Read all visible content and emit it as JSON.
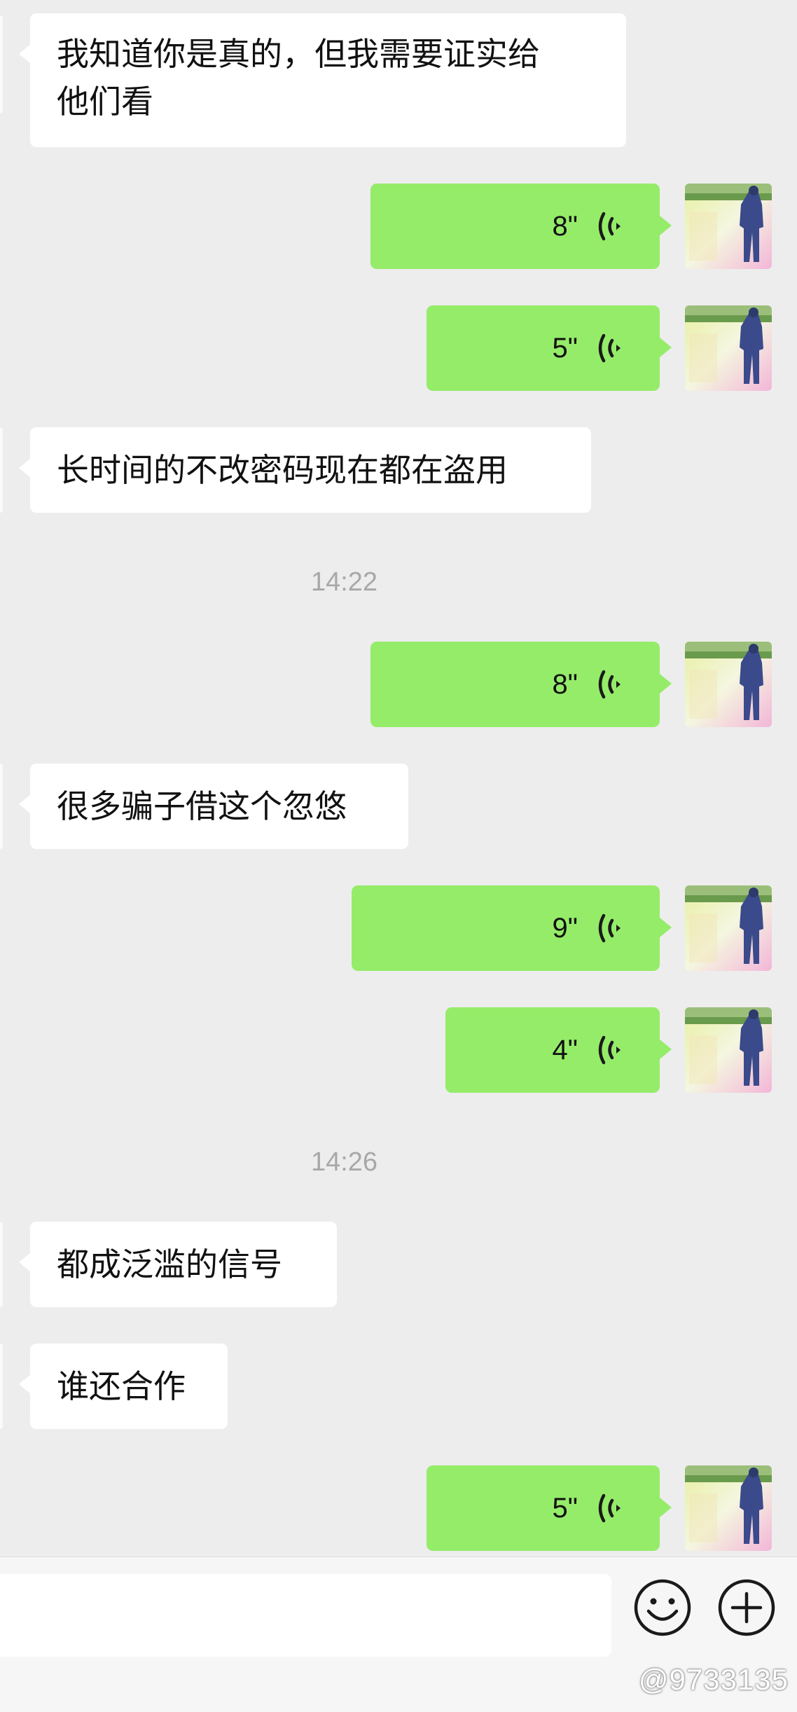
{
  "chat": {
    "messages": [
      {
        "kind": "in",
        "lines": [
          "我知道你是真的，但我需要证实给",
          "他们看"
        ]
      },
      {
        "kind": "voice_out",
        "duration": "8\""
      },
      {
        "kind": "voice_out",
        "duration": "5\""
      },
      {
        "kind": "in",
        "lines": [
          "长时间的不改密码现在都在盗用"
        ]
      },
      {
        "kind": "time",
        "text": "14:22"
      },
      {
        "kind": "voice_out",
        "duration": "8\""
      },
      {
        "kind": "in",
        "lines": [
          "很多骗子借这个忽悠"
        ]
      },
      {
        "kind": "voice_out",
        "duration": "9\""
      },
      {
        "kind": "voice_out",
        "duration": "4\""
      },
      {
        "kind": "time",
        "text": "14:26"
      },
      {
        "kind": "in",
        "lines": [
          "都成泛滥的信号"
        ]
      },
      {
        "kind": "in",
        "lines": [
          "谁还合作"
        ]
      },
      {
        "kind": "voice_out",
        "duration": "5\""
      }
    ]
  },
  "input_bar": {
    "placeholder": "",
    "emoji_icon": "emoji-icon",
    "plus_icon": "plus-icon"
  },
  "watermark": "@9733135",
  "colors": {
    "background": "#ededed",
    "incoming_bubble": "#ffffff",
    "outgoing_bubble": "#95ec69",
    "timestamp": "#a8a8a8",
    "input_bar": "#f6f6f6"
  }
}
